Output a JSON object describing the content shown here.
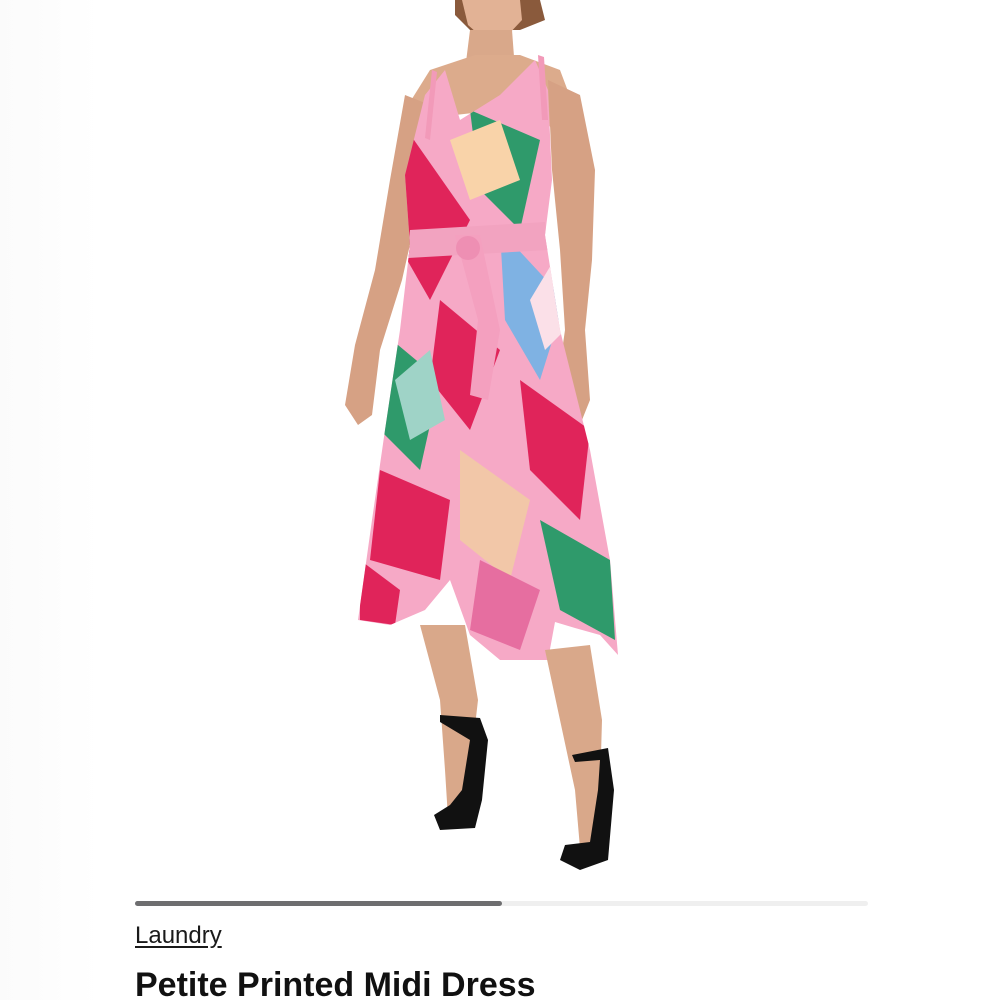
{
  "gallery": {
    "image_label": "product-photo",
    "progress": 0.5
  },
  "product": {
    "brand": "Laundry",
    "title": "Petite Printed Midi Dress"
  },
  "colors": {
    "dress_base": "#f6a9c6",
    "dress_red": "#e0245a",
    "dress_green": "#2f9a6b",
    "dress_blue": "#7fb2e3",
    "skin": "#d9a88a",
    "hair": "#8a5a3c",
    "shoes": "#111111"
  }
}
